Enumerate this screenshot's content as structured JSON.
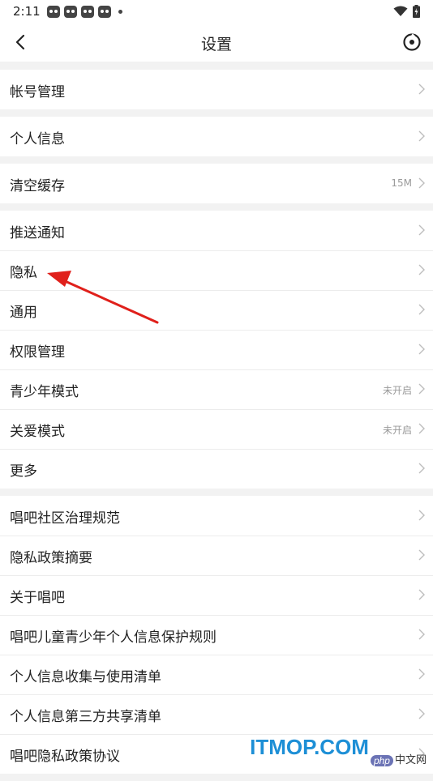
{
  "status_bar": {
    "time": "2:11"
  },
  "header": {
    "title": "设置"
  },
  "groups": [
    {
      "items": [
        {
          "label": "帐号管理",
          "value": ""
        }
      ]
    },
    {
      "items": [
        {
          "label": "个人信息",
          "value": ""
        }
      ]
    },
    {
      "items": [
        {
          "label": "清空缓存",
          "value": "15M"
        }
      ]
    },
    {
      "items": [
        {
          "label": "推送通知",
          "value": ""
        },
        {
          "label": "隐私",
          "value": ""
        },
        {
          "label": "通用",
          "value": ""
        },
        {
          "label": "权限管理",
          "value": ""
        },
        {
          "label": "青少年模式",
          "value": "未开启"
        },
        {
          "label": "关爱模式",
          "value": "未开启"
        },
        {
          "label": "更多",
          "value": ""
        }
      ]
    },
    {
      "items": [
        {
          "label": "唱吧社区治理规范",
          "value": ""
        },
        {
          "label": "隐私政策摘要",
          "value": ""
        },
        {
          "label": "关于唱吧",
          "value": ""
        },
        {
          "label": "唱吧儿童青少年个人信息保护规则",
          "value": ""
        },
        {
          "label": "个人信息收集与使用清单",
          "value": ""
        },
        {
          "label": "个人信息第三方共享清单",
          "value": ""
        },
        {
          "label": "唱吧隐私政策协议",
          "value": ""
        }
      ]
    }
  ],
  "annotation": {
    "color": "#e0201b",
    "points_to": "隐私"
  },
  "watermark": {
    "main": "ITMOP.COM",
    "php": "php",
    "sub": "中文网"
  },
  "icons": {
    "back": "back-arrow-icon",
    "target": "target-icon",
    "chevron": "chevron-right-icon",
    "wifi": "wifi-icon",
    "battery": "battery-icon",
    "notification": "notification-app-icon"
  }
}
